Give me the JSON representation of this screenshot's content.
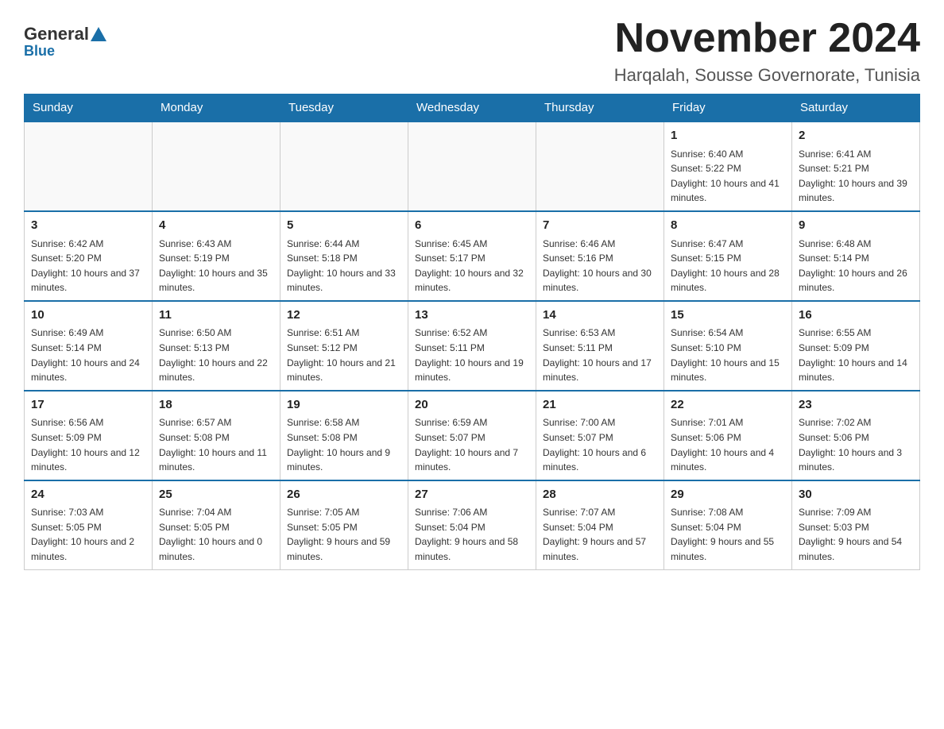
{
  "logo": {
    "general": "General",
    "blue": "Blue"
  },
  "header": {
    "month_year": "November 2024",
    "location": "Harqalah, Sousse Governorate, Tunisia"
  },
  "days_of_week": [
    "Sunday",
    "Monday",
    "Tuesday",
    "Wednesday",
    "Thursday",
    "Friday",
    "Saturday"
  ],
  "weeks": [
    [
      {
        "day": "",
        "info": ""
      },
      {
        "day": "",
        "info": ""
      },
      {
        "day": "",
        "info": ""
      },
      {
        "day": "",
        "info": ""
      },
      {
        "day": "",
        "info": ""
      },
      {
        "day": "1",
        "info": "Sunrise: 6:40 AM\nSunset: 5:22 PM\nDaylight: 10 hours and 41 minutes."
      },
      {
        "day": "2",
        "info": "Sunrise: 6:41 AM\nSunset: 5:21 PM\nDaylight: 10 hours and 39 minutes."
      }
    ],
    [
      {
        "day": "3",
        "info": "Sunrise: 6:42 AM\nSunset: 5:20 PM\nDaylight: 10 hours and 37 minutes."
      },
      {
        "day": "4",
        "info": "Sunrise: 6:43 AM\nSunset: 5:19 PM\nDaylight: 10 hours and 35 minutes."
      },
      {
        "day": "5",
        "info": "Sunrise: 6:44 AM\nSunset: 5:18 PM\nDaylight: 10 hours and 33 minutes."
      },
      {
        "day": "6",
        "info": "Sunrise: 6:45 AM\nSunset: 5:17 PM\nDaylight: 10 hours and 32 minutes."
      },
      {
        "day": "7",
        "info": "Sunrise: 6:46 AM\nSunset: 5:16 PM\nDaylight: 10 hours and 30 minutes."
      },
      {
        "day": "8",
        "info": "Sunrise: 6:47 AM\nSunset: 5:15 PM\nDaylight: 10 hours and 28 minutes."
      },
      {
        "day": "9",
        "info": "Sunrise: 6:48 AM\nSunset: 5:14 PM\nDaylight: 10 hours and 26 minutes."
      }
    ],
    [
      {
        "day": "10",
        "info": "Sunrise: 6:49 AM\nSunset: 5:14 PM\nDaylight: 10 hours and 24 minutes."
      },
      {
        "day": "11",
        "info": "Sunrise: 6:50 AM\nSunset: 5:13 PM\nDaylight: 10 hours and 22 minutes."
      },
      {
        "day": "12",
        "info": "Sunrise: 6:51 AM\nSunset: 5:12 PM\nDaylight: 10 hours and 21 minutes."
      },
      {
        "day": "13",
        "info": "Sunrise: 6:52 AM\nSunset: 5:11 PM\nDaylight: 10 hours and 19 minutes."
      },
      {
        "day": "14",
        "info": "Sunrise: 6:53 AM\nSunset: 5:11 PM\nDaylight: 10 hours and 17 minutes."
      },
      {
        "day": "15",
        "info": "Sunrise: 6:54 AM\nSunset: 5:10 PM\nDaylight: 10 hours and 15 minutes."
      },
      {
        "day": "16",
        "info": "Sunrise: 6:55 AM\nSunset: 5:09 PM\nDaylight: 10 hours and 14 minutes."
      }
    ],
    [
      {
        "day": "17",
        "info": "Sunrise: 6:56 AM\nSunset: 5:09 PM\nDaylight: 10 hours and 12 minutes."
      },
      {
        "day": "18",
        "info": "Sunrise: 6:57 AM\nSunset: 5:08 PM\nDaylight: 10 hours and 11 minutes."
      },
      {
        "day": "19",
        "info": "Sunrise: 6:58 AM\nSunset: 5:08 PM\nDaylight: 10 hours and 9 minutes."
      },
      {
        "day": "20",
        "info": "Sunrise: 6:59 AM\nSunset: 5:07 PM\nDaylight: 10 hours and 7 minutes."
      },
      {
        "day": "21",
        "info": "Sunrise: 7:00 AM\nSunset: 5:07 PM\nDaylight: 10 hours and 6 minutes."
      },
      {
        "day": "22",
        "info": "Sunrise: 7:01 AM\nSunset: 5:06 PM\nDaylight: 10 hours and 4 minutes."
      },
      {
        "day": "23",
        "info": "Sunrise: 7:02 AM\nSunset: 5:06 PM\nDaylight: 10 hours and 3 minutes."
      }
    ],
    [
      {
        "day": "24",
        "info": "Sunrise: 7:03 AM\nSunset: 5:05 PM\nDaylight: 10 hours and 2 minutes."
      },
      {
        "day": "25",
        "info": "Sunrise: 7:04 AM\nSunset: 5:05 PM\nDaylight: 10 hours and 0 minutes."
      },
      {
        "day": "26",
        "info": "Sunrise: 7:05 AM\nSunset: 5:05 PM\nDaylight: 9 hours and 59 minutes."
      },
      {
        "day": "27",
        "info": "Sunrise: 7:06 AM\nSunset: 5:04 PM\nDaylight: 9 hours and 58 minutes."
      },
      {
        "day": "28",
        "info": "Sunrise: 7:07 AM\nSunset: 5:04 PM\nDaylight: 9 hours and 57 minutes."
      },
      {
        "day": "29",
        "info": "Sunrise: 7:08 AM\nSunset: 5:04 PM\nDaylight: 9 hours and 55 minutes."
      },
      {
        "day": "30",
        "info": "Sunrise: 7:09 AM\nSunset: 5:03 PM\nDaylight: 9 hours and 54 minutes."
      }
    ]
  ]
}
